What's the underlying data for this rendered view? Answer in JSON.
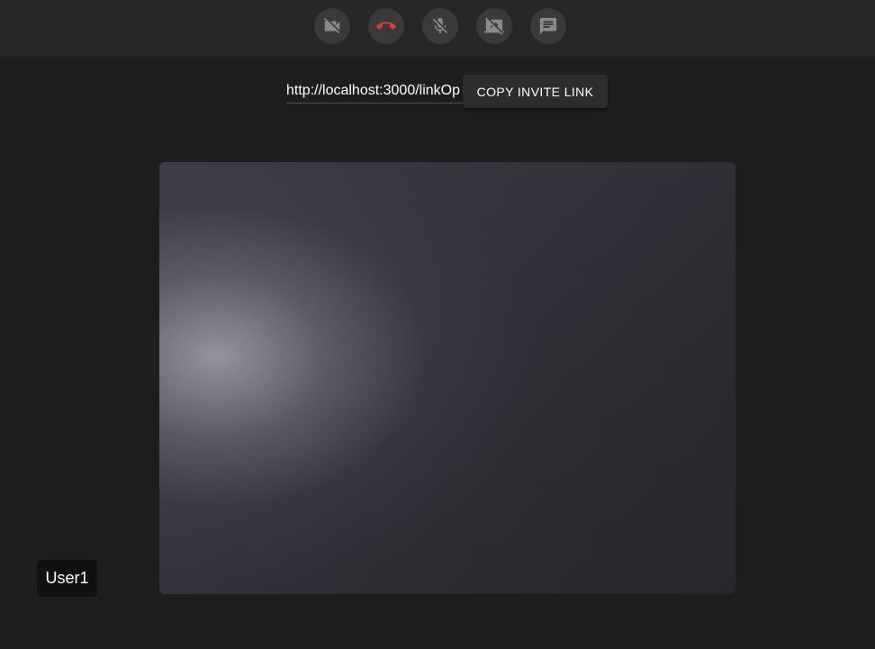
{
  "toolbar": {
    "buttons": [
      {
        "name": "camera-off",
        "icon": "videocam-off-icon"
      },
      {
        "name": "hang-up",
        "icon": "call-end-icon",
        "color": "#e53935"
      },
      {
        "name": "mic-off",
        "icon": "mic-off-icon"
      },
      {
        "name": "screen-share-off",
        "icon": "stop-screen-share-icon"
      },
      {
        "name": "chat",
        "icon": "chat-icon"
      }
    ],
    "icon_color": "#8a8a8a"
  },
  "invite": {
    "link_value": "http://localhost:3000/linkOp",
    "copy_label": "COPY INVITE LINK"
  },
  "participant": {
    "name": "User1"
  },
  "colors": {
    "background": "#1e1e1e",
    "toolbar": "#262626",
    "danger": "#e53935"
  }
}
